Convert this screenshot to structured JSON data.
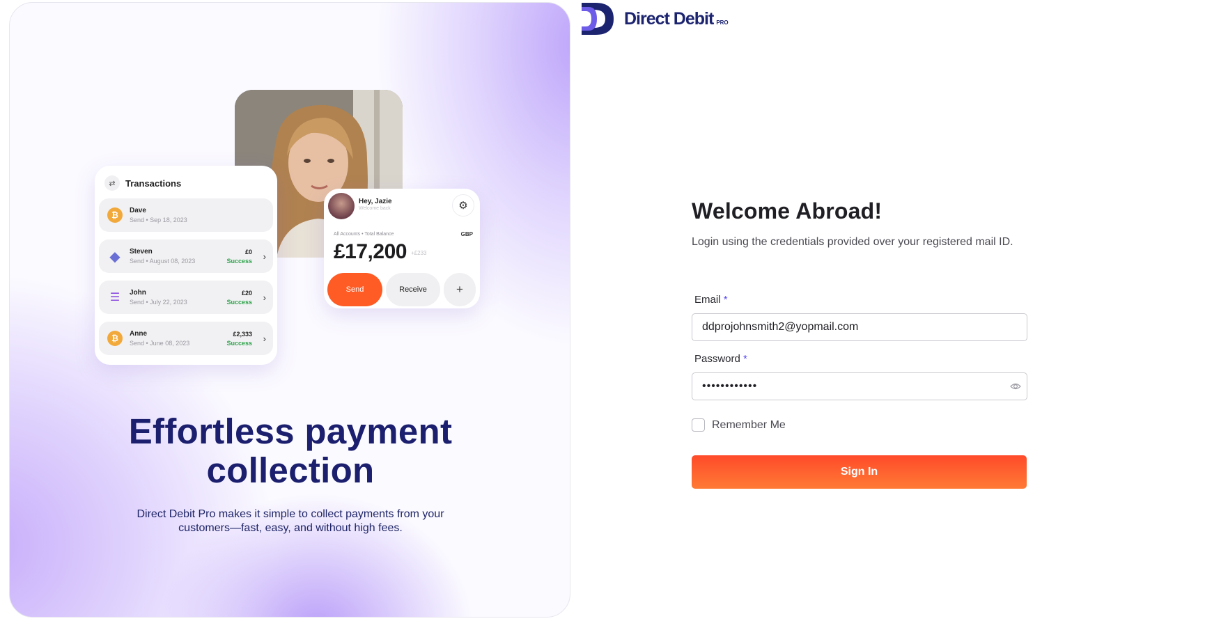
{
  "brand": {
    "name": "Direct Debit",
    "suffix": "PRO",
    "colors": {
      "navy": "#1c2470",
      "accent": "#ff5b24",
      "purple": "#b9a0fa"
    }
  },
  "hero": {
    "title_line1": "Effortless payment",
    "title_line2": "collection",
    "subtitle_line1": "Direct Debit Pro makes it simple to collect payments from your",
    "subtitle_line2": "customers—fast, easy, and without high fees."
  },
  "transactions_card": {
    "title": "Transactions",
    "icon": "swap-icon",
    "rows": [
      {
        "name": "Dave",
        "meta": "Send • Sep 18, 2023",
        "amount": "",
        "status": "",
        "coin": "bitcoin-icon"
      },
      {
        "name": "Steven",
        "meta": "Send • August 08, 2023",
        "amount": "£0",
        "status": "Success",
        "coin": "ethereum-icon"
      },
      {
        "name": "John",
        "meta": "Send • July 22, 2023",
        "amount": "£20",
        "status": "Success",
        "coin": "solana-icon"
      },
      {
        "name": "Anne",
        "meta": "Send • June 08, 2023",
        "amount": "£2,333",
        "status": "Success",
        "coin": "bitcoin-icon"
      }
    ]
  },
  "account_card": {
    "greeting": "Hey, Jazie",
    "greeting_sub": "Welcome back",
    "labels": "All Accounts  •  Total Balance",
    "currency": "GBP",
    "balance": "£17,200",
    "delta": "+£233",
    "send_label": "Send",
    "receive_label": "Receive",
    "plus_label": "+"
  },
  "login": {
    "title": "Welcome Abroad!",
    "subtitle": "Login using the credentials provided over your registered mail ID.",
    "email_label": "Email",
    "email_value": "ddprojohnsmith2@yopmail.com",
    "password_label": "Password",
    "password_value": "••••••••••••",
    "required_mark": "*",
    "remember_label": "Remember Me",
    "signin_label": "Sign In"
  }
}
